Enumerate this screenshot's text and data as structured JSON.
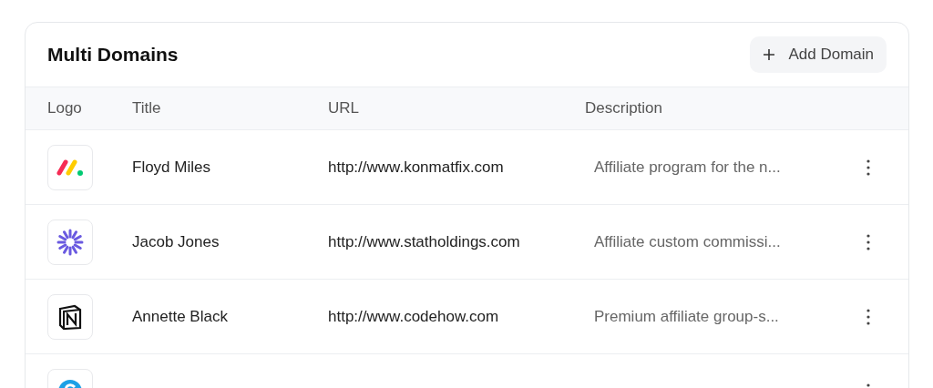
{
  "card": {
    "title": "Multi Domains",
    "add_button": {
      "label": "Add Domain"
    }
  },
  "table": {
    "columns": [
      "Logo",
      "Title",
      "URL",
      "Description"
    ],
    "rows": [
      {
        "logo": {
          "kind": "bars"
        },
        "title": "Floyd Miles",
        "url": "http://www.konmatfix.com",
        "description": "Affiliate program for the n..."
      },
      {
        "logo": {
          "kind": "burst"
        },
        "title": "Jacob Jones",
        "url": "http://www.statholdings.com",
        "description": "Affiliate custom commissi..."
      },
      {
        "logo": {
          "kind": "letter-block"
        },
        "title": "Annette Black",
        "url": "http://www.codehow.com",
        "description": "Premium affiliate group-s..."
      },
      {
        "logo": {
          "kind": "ring"
        }
      }
    ]
  }
}
